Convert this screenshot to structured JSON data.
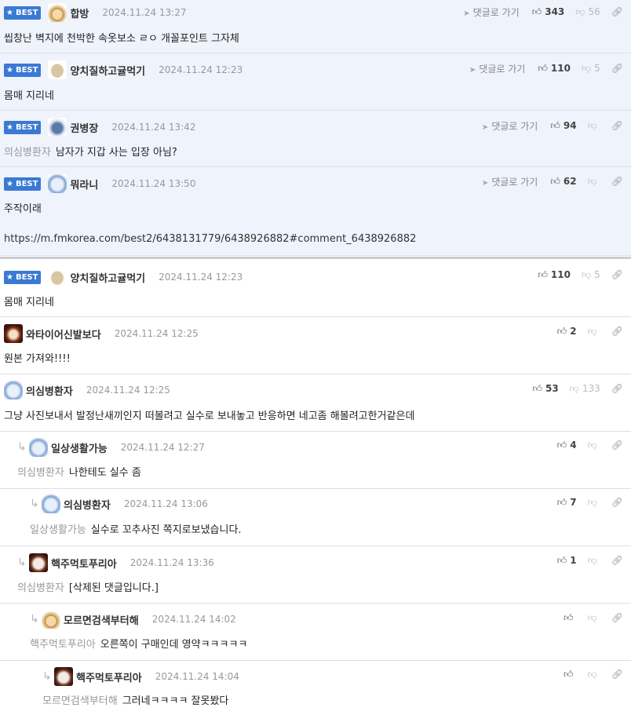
{
  "goto_label": "댓글로 가기",
  "best_label": "BEST",
  "comments": [
    {
      "nick": "합방",
      "date": "2024.11.24 13:27",
      "up": "343",
      "down": "56",
      "text": "씹창난 벽지에 천박한 속옷보소 ㄹㅇ 개꼴포인트 그자체",
      "avatar": "fox-icon"
    },
    {
      "nick": "양치질하고귤먹기",
      "date": "2024.11.24 12:23",
      "up": "110",
      "down": "5",
      "text": "몸매 지리네",
      "avatar": "potato-icon"
    },
    {
      "nick": "권병장",
      "date": "2024.11.24 13:42",
      "up": "94",
      "down": "",
      "mention": "의심병환자",
      "text": "남자가 지갑 사는 입장 아님?",
      "avatar": "bear-icon"
    },
    {
      "nick": "뭐라니",
      "date": "2024.11.24 13:50",
      "up": "62",
      "down": "",
      "text": "주작이래",
      "url": "https://m.fmkorea.com/best2/6438131779/6438926882#comment_6438926882",
      "avatar": "seal-icon"
    },
    {
      "nick": "양치질하고귤먹기",
      "date": "2024.11.24 12:23",
      "up": "110",
      "down": "5",
      "text": "몸매 지리네",
      "avatar": "potato-icon"
    },
    {
      "nick": "와타이어신발보다",
      "date": "2024.11.24 12:25",
      "up": "2",
      "down": "",
      "text": "원본 가져와!!!!",
      "avatar": "lion-icon"
    },
    {
      "nick": "의심병환자",
      "date": "2024.11.24 12:25",
      "up": "53",
      "down": "133",
      "text": "그냥 사진보내서 발정난새끼인지 떠볼려고 실수로 보내놓고 반응하면 네고좀 해볼려고한거같은데",
      "avatar": "seal-icon"
    },
    {
      "nick": "일상생활가능",
      "date": "2024.11.24 12:27",
      "up": "4",
      "down": "",
      "mention": "의심병환자",
      "text": "나한테도 실수 좀",
      "avatar": "seal-icon"
    },
    {
      "nick": "의심병환자",
      "date": "2024.11.24 13:06",
      "up": "7",
      "down": "",
      "mention": "일상생활가능",
      "text": "실수로 꼬추사진 쪽지로보냈습니다.",
      "avatar": "seal-icon"
    },
    {
      "nick": "핵주먹토푸리아",
      "date": "2024.11.24 13:36",
      "up": "1",
      "down": "",
      "mention": "의심병환자",
      "text": "[삭제된 댓글입니다.]",
      "avatar": "dog-icon"
    },
    {
      "nick": "모르면검색부터해",
      "date": "2024.11.24 14:02",
      "up": "",
      "down": "",
      "mention": "핵주먹토푸리아",
      "text": "오른쪽이 구매인데 영약ㅋㅋㅋㅋㅋ",
      "avatar": "fox-icon"
    },
    {
      "nick": "핵주먹토푸리아",
      "date": "2024.11.24 14:04",
      "up": "",
      "down": "",
      "mention": "모르면검색부터해",
      "text": "그러네ㅋㅋㅋㅋ 잘못봤다",
      "avatar": "dog-icon"
    }
  ]
}
